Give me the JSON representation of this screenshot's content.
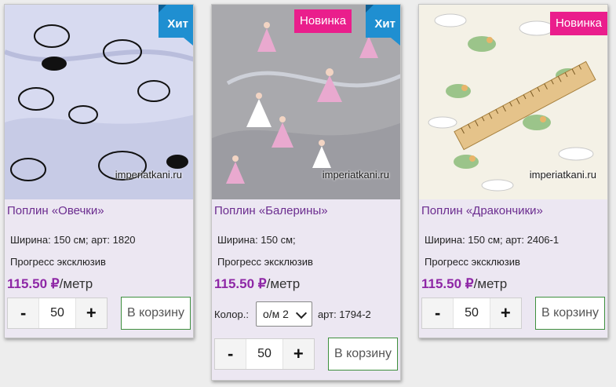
{
  "products": [
    {
      "title": "Поплин «Овечки»",
      "watermark": "imperiatkani.ru",
      "badges": {
        "hit": "Хит"
      },
      "spec_line1": "Ширина: 150 см; арт: 1820",
      "spec_line2": "Прогресс эксклюзив",
      "price_value": "115.50 ₽",
      "price_unit": "/метр",
      "minus": "-",
      "plus": "+",
      "quantity": "50",
      "cart_label": "В корзину"
    },
    {
      "title": "Поплин «Балерины»",
      "watermark": "imperiatkani.ru",
      "badges": {
        "new": "Новинка",
        "hit": "Хит"
      },
      "spec_line1": "Ширина: 150 см;",
      "spec_line2": "Прогресс эксклюзив",
      "price_value": "115.50 ₽",
      "price_unit": "/метр",
      "color_label": "Колор.:",
      "color_selected": "о/м 2",
      "article": "арт: 1794-2",
      "minus": "-",
      "plus": "+",
      "quantity": "50",
      "cart_label": "В корзину"
    },
    {
      "title": "Поплин «Дракончики»",
      "watermark": "imperiatkani.ru",
      "badges": {
        "new": "Новинка"
      },
      "spec_line1": "Ширина: 150 см; арт: 2406-1",
      "spec_line2": "Прогресс эксклюзив",
      "price_value": "115.50 ₽",
      "price_unit": "/метр",
      "minus": "-",
      "plus": "+",
      "quantity": "50",
      "cart_label": "В корзину"
    }
  ],
  "colors": {
    "title": "#6b2c8f",
    "price": "#8e27a6",
    "badge_hit": "#1f8fd1",
    "badge_new": "#ea1e8c",
    "cart_border": "#3e8f3e"
  }
}
